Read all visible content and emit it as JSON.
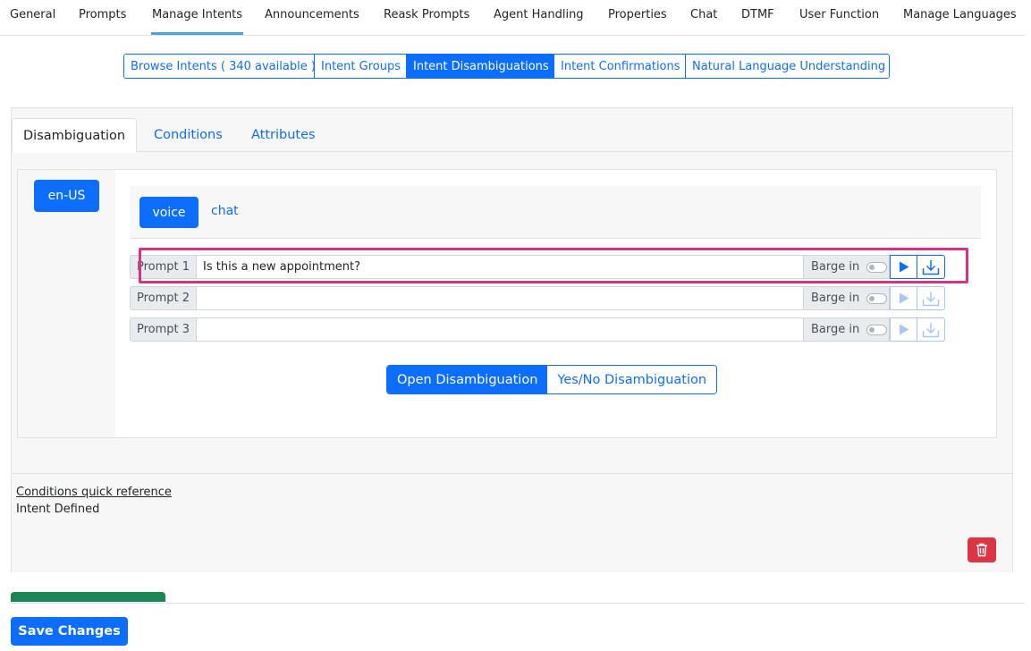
{
  "topnav": {
    "items": [
      "General",
      "Prompts",
      "Manage Intents",
      "Announcements",
      "Reask Prompts",
      "Agent Handling",
      "Properties",
      "Chat",
      "DTMF",
      "User Function",
      "Manage Languages"
    ],
    "active": "Manage Intents"
  },
  "subnav": {
    "items": [
      "Browse Intents ( 340 available )",
      "Intent Groups",
      "Intent Disambiguations",
      "Intent Confirmations",
      "Natural Language Understanding"
    ],
    "active": "Intent Disambiguations"
  },
  "tabs": {
    "items": [
      "Disambiguation",
      "Conditions",
      "Attributes"
    ],
    "active": "Disambiguation"
  },
  "language": {
    "selected": "en-US"
  },
  "channel": {
    "voice": "voice",
    "chat": "chat",
    "active": "voice"
  },
  "prompts": [
    {
      "label": "Prompt 1",
      "value": "Is this a new appointment?",
      "barge_label": "Barge in",
      "barge_in": false
    },
    {
      "label": "Prompt 2",
      "value": "",
      "barge_label": "Barge in",
      "barge_in": false
    },
    {
      "label": "Prompt 3",
      "value": "",
      "barge_label": "Barge in",
      "barge_in": false
    }
  ],
  "disambiguation_type": {
    "open": "Open Disambiguation",
    "yes_no": "Yes/No Disambiguation",
    "active": "Open Disambiguation"
  },
  "conditions": {
    "quick_reference": "Conditions quick reference",
    "keyword": "Intent",
    "value": " Defined"
  },
  "actions": {
    "save": "Save Changes"
  },
  "icons": [
    "play-icon",
    "download-icon",
    "trash-icon"
  ],
  "colors": {
    "primary": "#0d6efd",
    "danger": "#dc3545",
    "highlight": "#d63384",
    "success": "#198754"
  }
}
